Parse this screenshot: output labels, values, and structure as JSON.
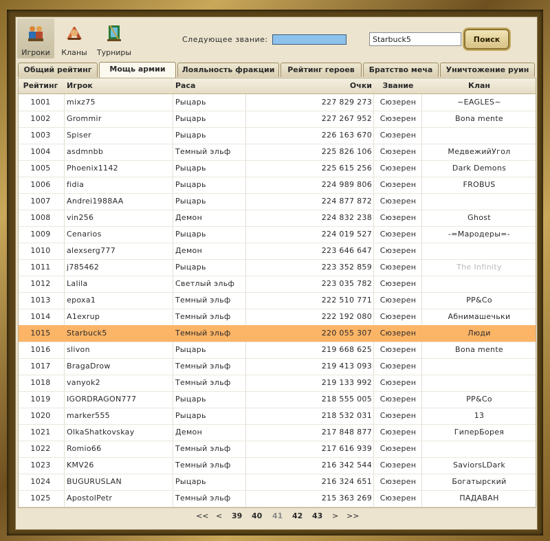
{
  "nav": [
    {
      "label": "Игроки",
      "icon": "players-icon",
      "active": true
    },
    {
      "label": "Кланы",
      "icon": "clans-icon",
      "active": false
    },
    {
      "label": "Турниры",
      "icon": "tournaments-icon",
      "active": false
    }
  ],
  "next_rank": {
    "label": "Следующее звание:",
    "progress": 1.0
  },
  "search": {
    "value": "Starbuck5",
    "button": "Поиск"
  },
  "tabs": [
    {
      "label": "Общий рейтинг",
      "active": false
    },
    {
      "label": "Мощь армии",
      "active": true
    },
    {
      "label": "Лояльность фракции",
      "active": false
    },
    {
      "label": "Рейтинг героев",
      "active": false
    },
    {
      "label": "Братство меча",
      "active": false
    },
    {
      "label": "Уничтожение руин",
      "active": false
    }
  ],
  "table": {
    "headers": [
      "Рейтинг",
      "Игрок",
      "Раса",
      "Очки",
      "Звание",
      "Клан"
    ],
    "highlight_color": "#fcb467",
    "rows": [
      {
        "rank": "1001",
        "player": "mixz75",
        "race": "Рыцарь",
        "points": "227 829 273",
        "title": "Сюзерен",
        "clan": "~EAGLES~"
      },
      {
        "rank": "1002",
        "player": "Grommir",
        "race": "Рыцарь",
        "points": "227 267 952",
        "title": "Сюзерен",
        "clan": "Bona mente"
      },
      {
        "rank": "1003",
        "player": "Spiser",
        "race": "Рыцарь",
        "points": "226 163 670",
        "title": "Сюзерен",
        "clan": ""
      },
      {
        "rank": "1004",
        "player": "asdmnbb",
        "race": "Темный эльф",
        "points": "225 826 106",
        "title": "Сюзерен",
        "clan": "МедвежийУгол"
      },
      {
        "rank": "1005",
        "player": "Phoenix1142",
        "race": "Рыцарь",
        "points": "225 615 256",
        "title": "Сюзерен",
        "clan": "Dark Demons"
      },
      {
        "rank": "1006",
        "player": "fidia",
        "race": "Рыцарь",
        "points": "224 989 806",
        "title": "Сюзерен",
        "clan": "FROBUS"
      },
      {
        "rank": "1007",
        "player": "Andrei1988AA",
        "race": "Рыцарь",
        "points": "224 877 872",
        "title": "Сюзерен",
        "clan": ""
      },
      {
        "rank": "1008",
        "player": "vin256",
        "race": "Демон",
        "points": "224 832 238",
        "title": "Сюзерен",
        "clan": "Ghost"
      },
      {
        "rank": "1009",
        "player": "Cenarios",
        "race": "Рыцарь",
        "points": "224 019 527",
        "title": "Сюзерен",
        "clan": "-=Мародеры=-"
      },
      {
        "rank": "1010",
        "player": "alexserg777",
        "race": "Демон",
        "points": "223 646 647",
        "title": "Сюзерен",
        "clan": ""
      },
      {
        "rank": "1011",
        "player": "j785462",
        "race": "Рыцарь",
        "points": "223 352 859",
        "title": "Сюзерен",
        "clan": "The Infinity",
        "clan_faded": true
      },
      {
        "rank": "1012",
        "player": "Lalila",
        "race": "Светлый эльф",
        "points": "223 035 782",
        "title": "Сюзерен",
        "clan": ""
      },
      {
        "rank": "1013",
        "player": "epoxa1",
        "race": "Темный эльф",
        "points": "222 510 771",
        "title": "Сюзерен",
        "clan": "PP&Co"
      },
      {
        "rank": "1014",
        "player": "A1exrup",
        "race": "Темный эльф",
        "points": "222 192 080",
        "title": "Сюзерен",
        "clan": "Абнимашечьки"
      },
      {
        "rank": "1015",
        "player": "Starbuck5",
        "race": "Темный эльф",
        "points": "220 055 307",
        "title": "Сюзерен",
        "clan": "Люди",
        "highlight": true
      },
      {
        "rank": "1016",
        "player": "slivon",
        "race": "Рыцарь",
        "points": "219 668 625",
        "title": "Сюзерен",
        "clan": "Bona mente"
      },
      {
        "rank": "1017",
        "player": "BragaDrow",
        "race": "Темный эльф",
        "points": "219 413 093",
        "title": "Сюзерен",
        "clan": ""
      },
      {
        "rank": "1018",
        "player": "vanyok2",
        "race": "Темный эльф",
        "points": "219 133 992",
        "title": "Сюзерен",
        "clan": ""
      },
      {
        "rank": "1019",
        "player": "IGORDRAGON777",
        "race": "Рыцарь",
        "points": "218 555 005",
        "title": "Сюзерен",
        "clan": "PP&Co"
      },
      {
        "rank": "1020",
        "player": "marker555",
        "race": "Рыцарь",
        "points": "218 532 031",
        "title": "Сюзерен",
        "clan": "13"
      },
      {
        "rank": "1021",
        "player": "OlkaShatkovskay",
        "race": "Демон",
        "points": "217 848 877",
        "title": "Сюзерен",
        "clan": "ГиперБорея"
      },
      {
        "rank": "1022",
        "player": "Romio66",
        "race": "Темный эльф",
        "points": "217 616 939",
        "title": "Сюзерен",
        "clan": ""
      },
      {
        "rank": "1023",
        "player": "KMV26",
        "race": "Темный эльф",
        "points": "216 342 544",
        "title": "Сюзерен",
        "clan": "SaviorsLDark"
      },
      {
        "rank": "1024",
        "player": "BUGURUSLAN",
        "race": "Рыцарь",
        "points": "216 324 651",
        "title": "Сюзерен",
        "clan": "Богатырский"
      },
      {
        "rank": "1025",
        "player": "ApostolPetr",
        "race": "Темный эльф",
        "points": "215 363 269",
        "title": "Сюзерен",
        "clan": "ПАДАВАН"
      }
    ]
  },
  "pagination": {
    "first": "<<",
    "prev": "<",
    "pages": [
      "39",
      "40",
      "41",
      "42",
      "43"
    ],
    "current": "41",
    "next": ">",
    "last": ">>"
  }
}
